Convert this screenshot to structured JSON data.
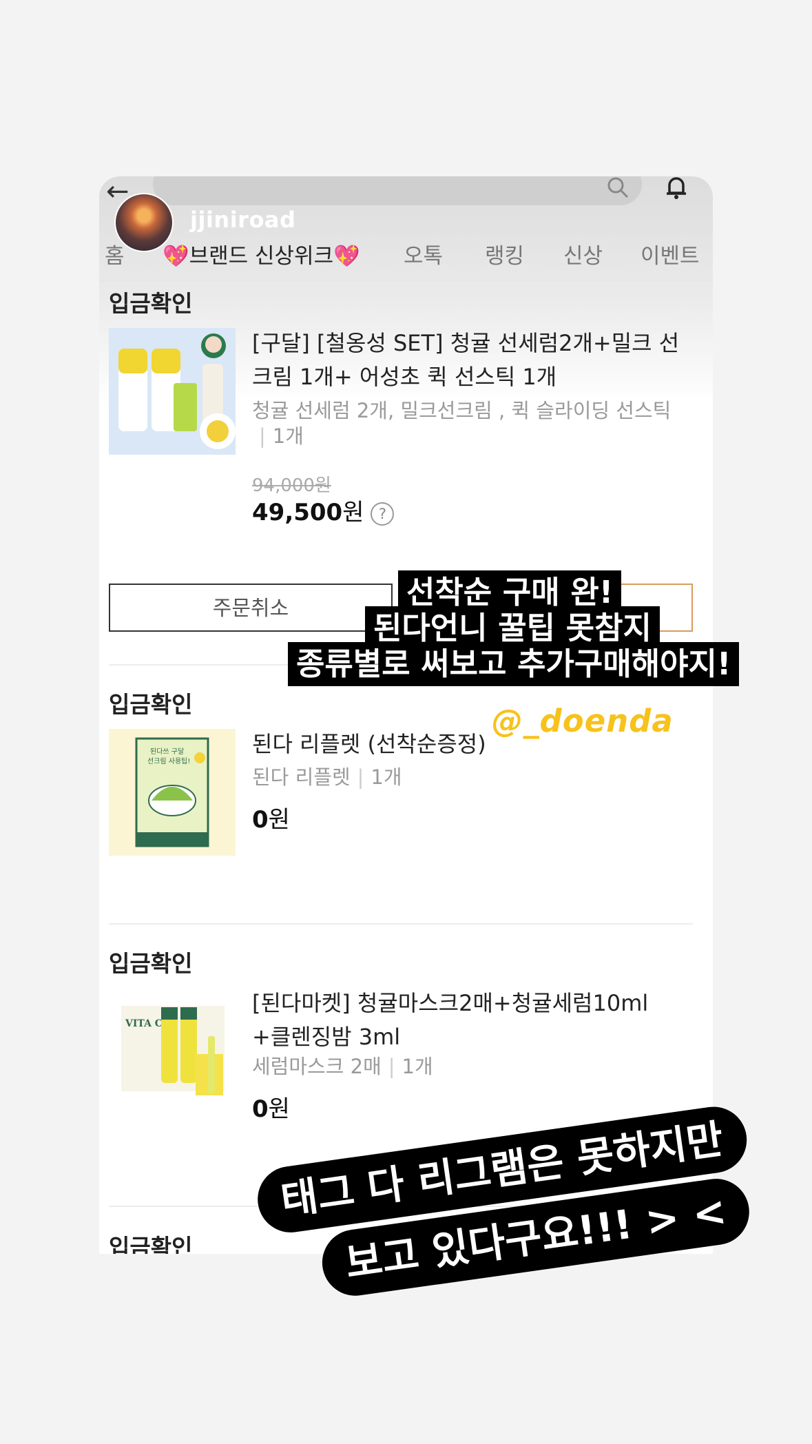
{
  "story": {
    "username": "jjiniroad"
  },
  "nav": {
    "tabs": [
      "홈",
      "💖브랜드 신상위크💖",
      "오톡",
      "랭킹",
      "신상",
      "이벤트"
    ]
  },
  "orders": [
    {
      "status": "입금확인",
      "name": "[구달] [철옹성 SET] 청귤 선세럼2개+밀크 선크림 1개+ 어성초 퀵 선스틱 1개",
      "option": "청귤 선세럼 2개, 밀크선크림 , 퀵 슬라이딩 선스틱",
      "qty": "1개",
      "original_price": "94,000원",
      "price_number": "49,500",
      "price_unit": "원",
      "help": "?",
      "cancel_label": "주문취소"
    },
    {
      "status": "입금확인",
      "name": "된다 리플렛 (선착순증정)",
      "option": "된다 리플렛",
      "qty": "1개",
      "price_number": "0",
      "price_unit": "원"
    },
    {
      "status": "입금확인",
      "name": "[된다마켓] 청귤마스크2매+청귤세럼10ml +클렌징밤 3ml",
      "option": "세럼마스크 2매",
      "qty": "1개",
      "price_number": "0",
      "price_unit": "원"
    },
    {
      "status": "입금확인"
    }
  ],
  "thumb_text": {
    "leaflet": "된다쓰 구달\n선크림 사용팁!",
    "vitac": "VITA C"
  },
  "overlay": {
    "caption_lines": [
      "선착순 구매 완!",
      "된다언니 꿀팁 못참지",
      "종류별로 써보고 추가구매해야지!"
    ],
    "watermark": "@_doenda",
    "bottom_lines": [
      "태그 다 리그램은 못하지만",
      "보고 있다구요!!! > <"
    ]
  },
  "colors": {
    "accent_border": "#d99b5d",
    "watermark": "#f7c21c"
  }
}
